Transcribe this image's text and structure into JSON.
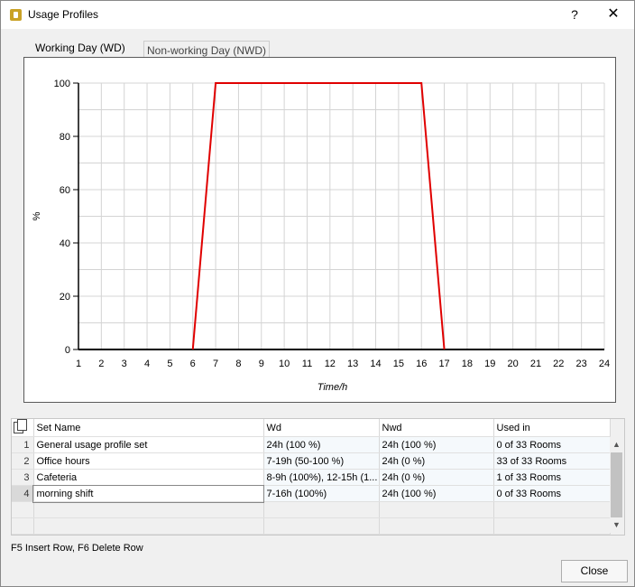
{
  "window": {
    "title": "Usage Profiles",
    "help_label": "?",
    "close_label": "✕"
  },
  "tabs": [
    {
      "label": "Working Day (WD)",
      "selected": true
    },
    {
      "label": "Non-working Day (NWD)",
      "selected": false
    }
  ],
  "chart_data": {
    "type": "line",
    "title": "",
    "xlabel": "Time/h",
    "ylabel": "%",
    "xlim": [
      1,
      24
    ],
    "ylim": [
      0,
      100
    ],
    "x_ticks": [
      1,
      2,
      3,
      4,
      5,
      6,
      7,
      8,
      9,
      10,
      11,
      12,
      13,
      14,
      15,
      16,
      17,
      18,
      19,
      20,
      21,
      22,
      23,
      24
    ],
    "y_ticks": [
      0,
      20,
      40,
      60,
      80,
      100
    ],
    "grid": true,
    "series": [
      {
        "color": "#e00000",
        "x": [
          6,
          7,
          16,
          17
        ],
        "y": [
          0,
          100,
          100,
          0
        ]
      }
    ],
    "baseline_color": "#000000"
  },
  "table": {
    "columns": [
      "Set Name",
      "Wd",
      "Nwd",
      "Used in"
    ],
    "rows": [
      {
        "num": "1",
        "name": "General usage profile set",
        "wd": "24h (100 %)",
        "nwd": "24h (100 %)",
        "used": "0 of 33 Rooms"
      },
      {
        "num": "2",
        "name": "Office hours",
        "wd": "7-19h (50-100 %)",
        "nwd": "24h (0 %)",
        "used": "33 of 33 Rooms"
      },
      {
        "num": "3",
        "name": "Cafeteria",
        "wd": "8-9h (100%), 12-15h (1...",
        "nwd": "24h (0 %)",
        "used": "1 of 33 Rooms"
      },
      {
        "num": "4",
        "name": "morning shift",
        "wd": "7-16h (100%)",
        "nwd": "24h (100 %)",
        "used": "0 of 33 Rooms"
      }
    ],
    "ellipsis": "..."
  },
  "hint": "F5 Insert Row, F6 Delete Row",
  "close_button": "Close"
}
